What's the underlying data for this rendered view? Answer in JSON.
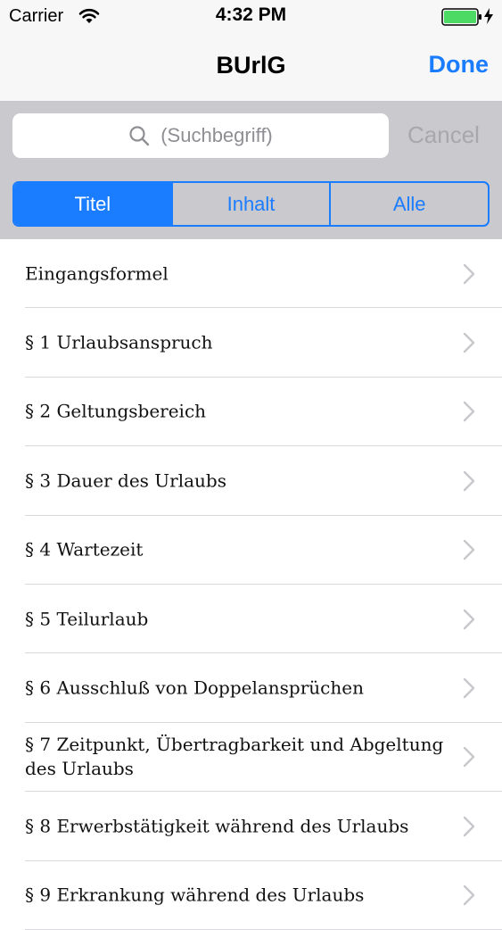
{
  "status_bar": {
    "carrier": "Carrier",
    "time": "4:32 PM",
    "wifi_icon": "wifi-icon",
    "battery_icon": "battery-icon",
    "battery_color": "#4cd964"
  },
  "nav": {
    "title": "BUrlG",
    "done_label": "Done",
    "accent_color": "#1a7cff"
  },
  "search": {
    "placeholder": "(Suchbegriff)",
    "cancel_label": "Cancel"
  },
  "scope": {
    "segments": [
      {
        "label": "Titel",
        "selected": true
      },
      {
        "label": "Inhalt",
        "selected": false
      },
      {
        "label": "Alle",
        "selected": false
      }
    ]
  },
  "list": {
    "items": [
      {
        "label": "Eingangsformel"
      },
      {
        "label": "§ 1 Urlaubsanspruch"
      },
      {
        "label": "§ 2 Geltungsbereich"
      },
      {
        "label": "§ 3 Dauer des Urlaubs"
      },
      {
        "label": "§ 4 Wartezeit"
      },
      {
        "label": "§ 5 Teilurlaub"
      },
      {
        "label": "§ 6 Ausschluß von Doppelansprüchen"
      },
      {
        "label": "§ 7 Zeitpunkt, Übertragbarkeit und Abgeltung des Urlaubs"
      },
      {
        "label": "§ 8 Erwerbstätigkeit während des Urlaubs"
      },
      {
        "label": "§ 9 Erkrankung während des Urlaubs"
      }
    ]
  }
}
